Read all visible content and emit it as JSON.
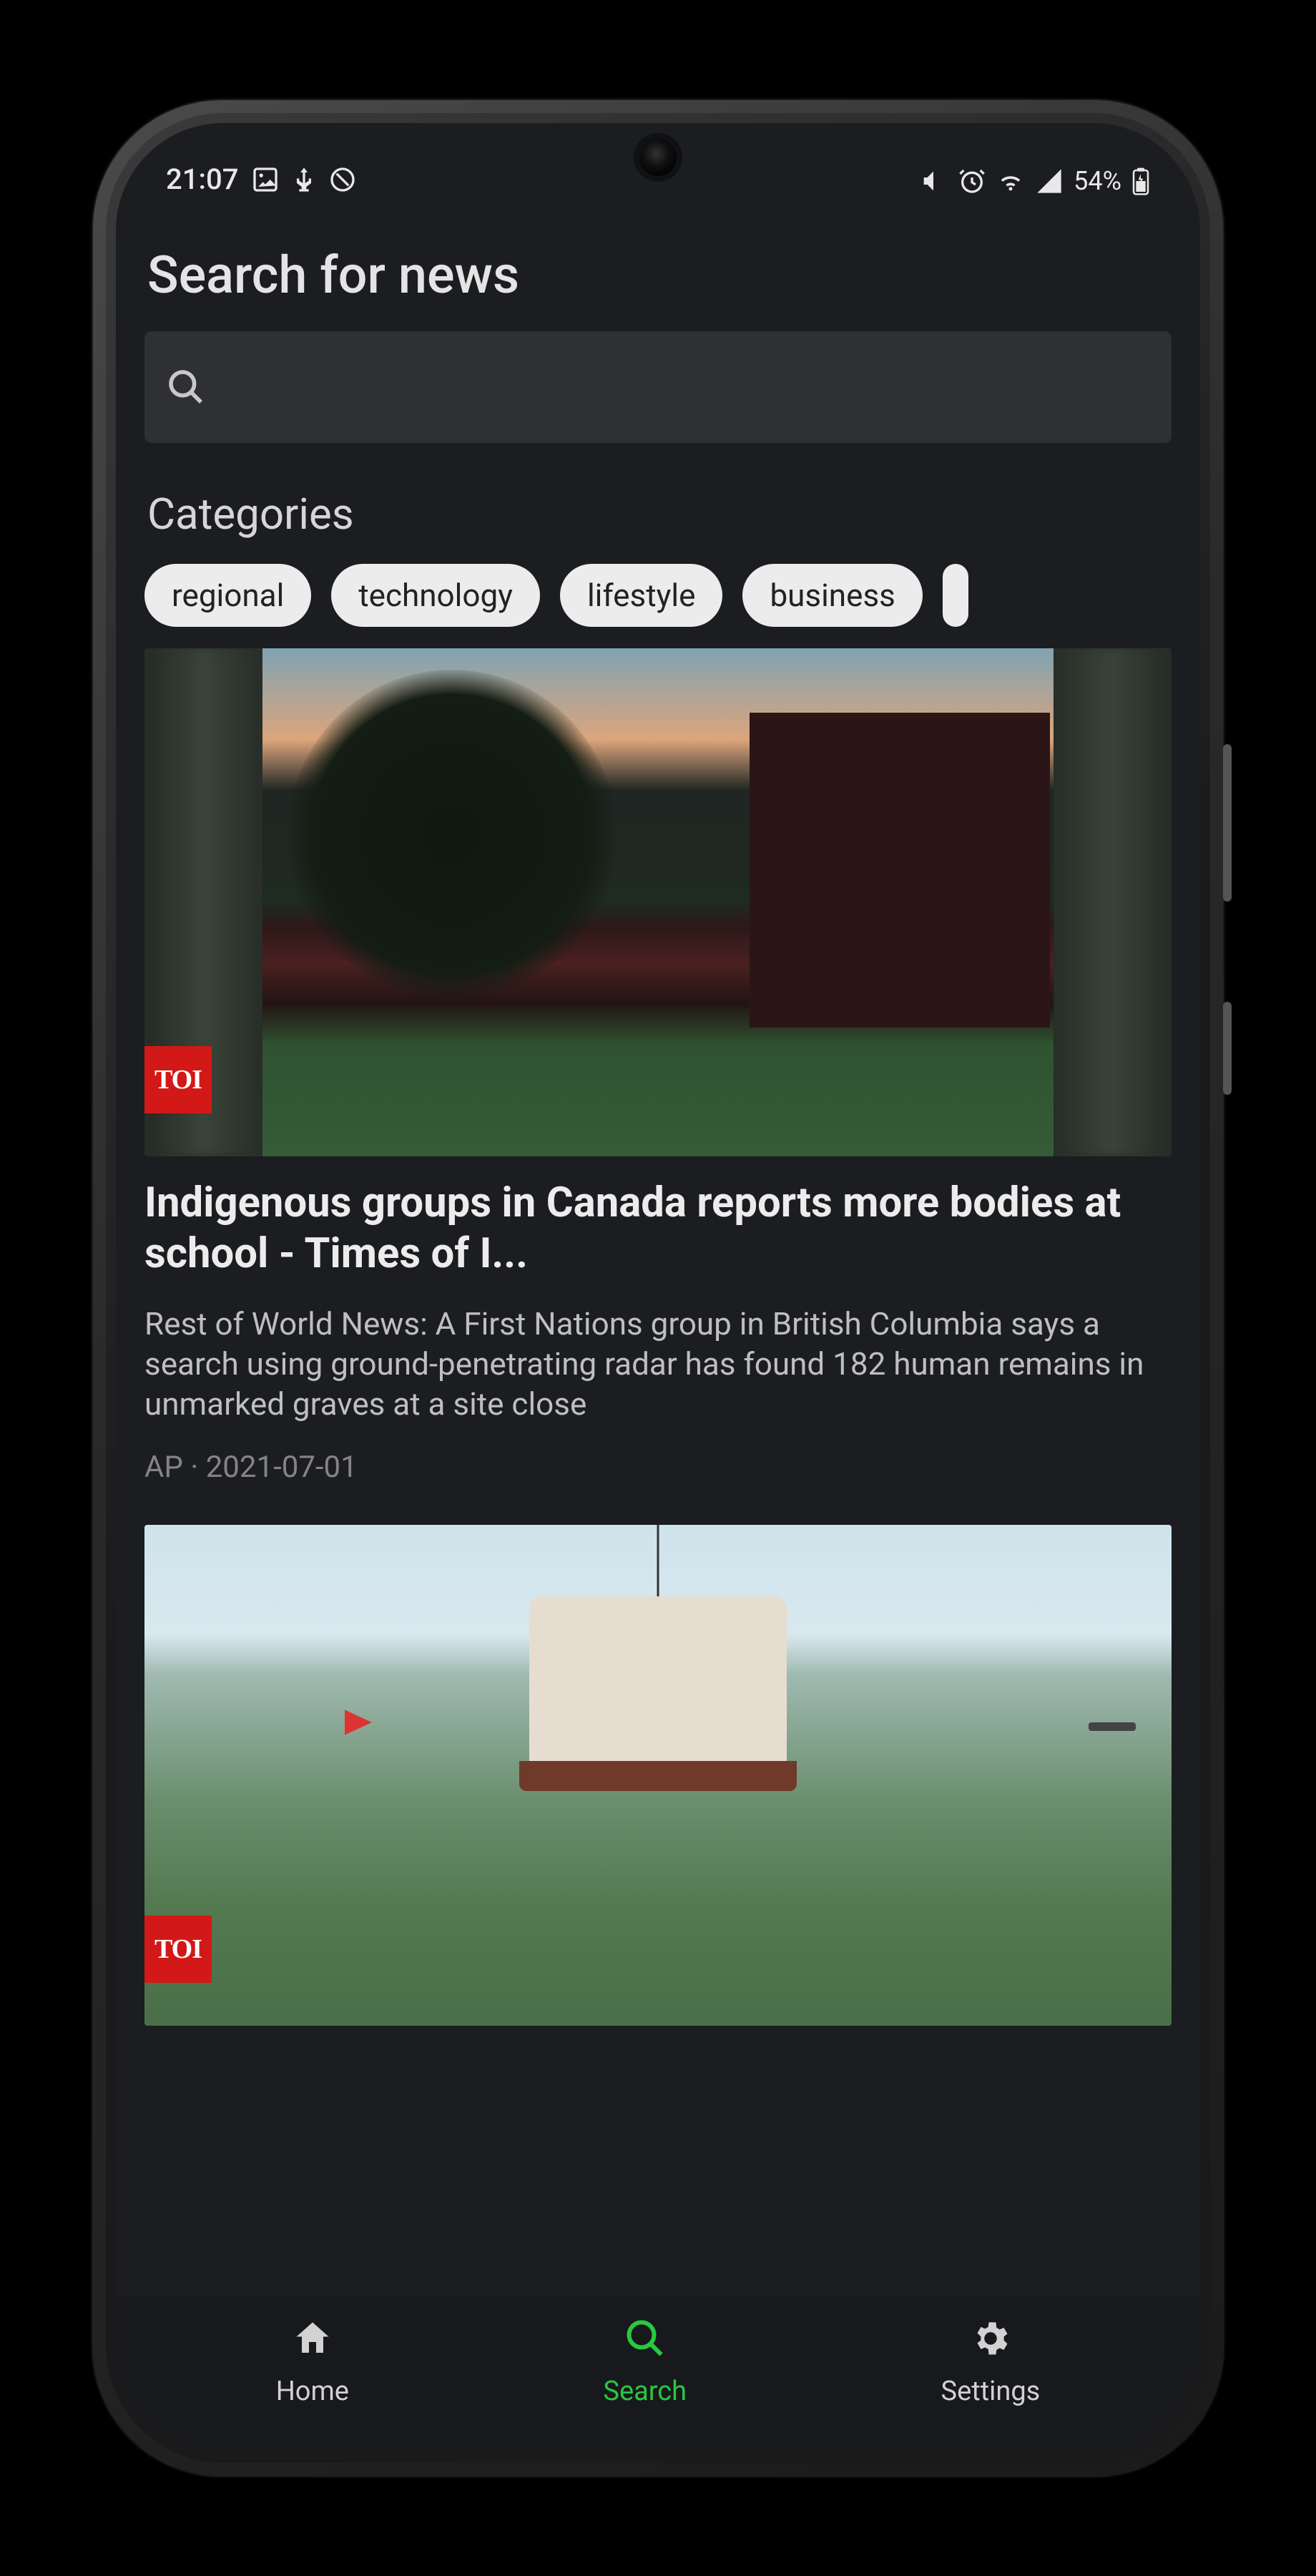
{
  "status": {
    "time": "21:07",
    "battery_text": "54%"
  },
  "page": {
    "title": "Search for news",
    "search_placeholder": ""
  },
  "categories": {
    "label": "Categories",
    "chips": [
      "regional",
      "technology",
      "lifestyle",
      "business"
    ]
  },
  "articles": [
    {
      "badge": "TOI",
      "title": "Indigenous groups in Canada reports more bodies at school - Times of I...",
      "description": "Rest of World News: A First Nations group in British Columbia says a search using ground-penetrating radar has found 182 human remains in unmarked graves at a site close",
      "author": "AP",
      "date": "2021-07-01",
      "meta": "AP · 2021-07-01"
    },
    {
      "badge": "TOI"
    }
  ],
  "nav": {
    "home": "Home",
    "search": "Search",
    "settings": "Settings"
  }
}
